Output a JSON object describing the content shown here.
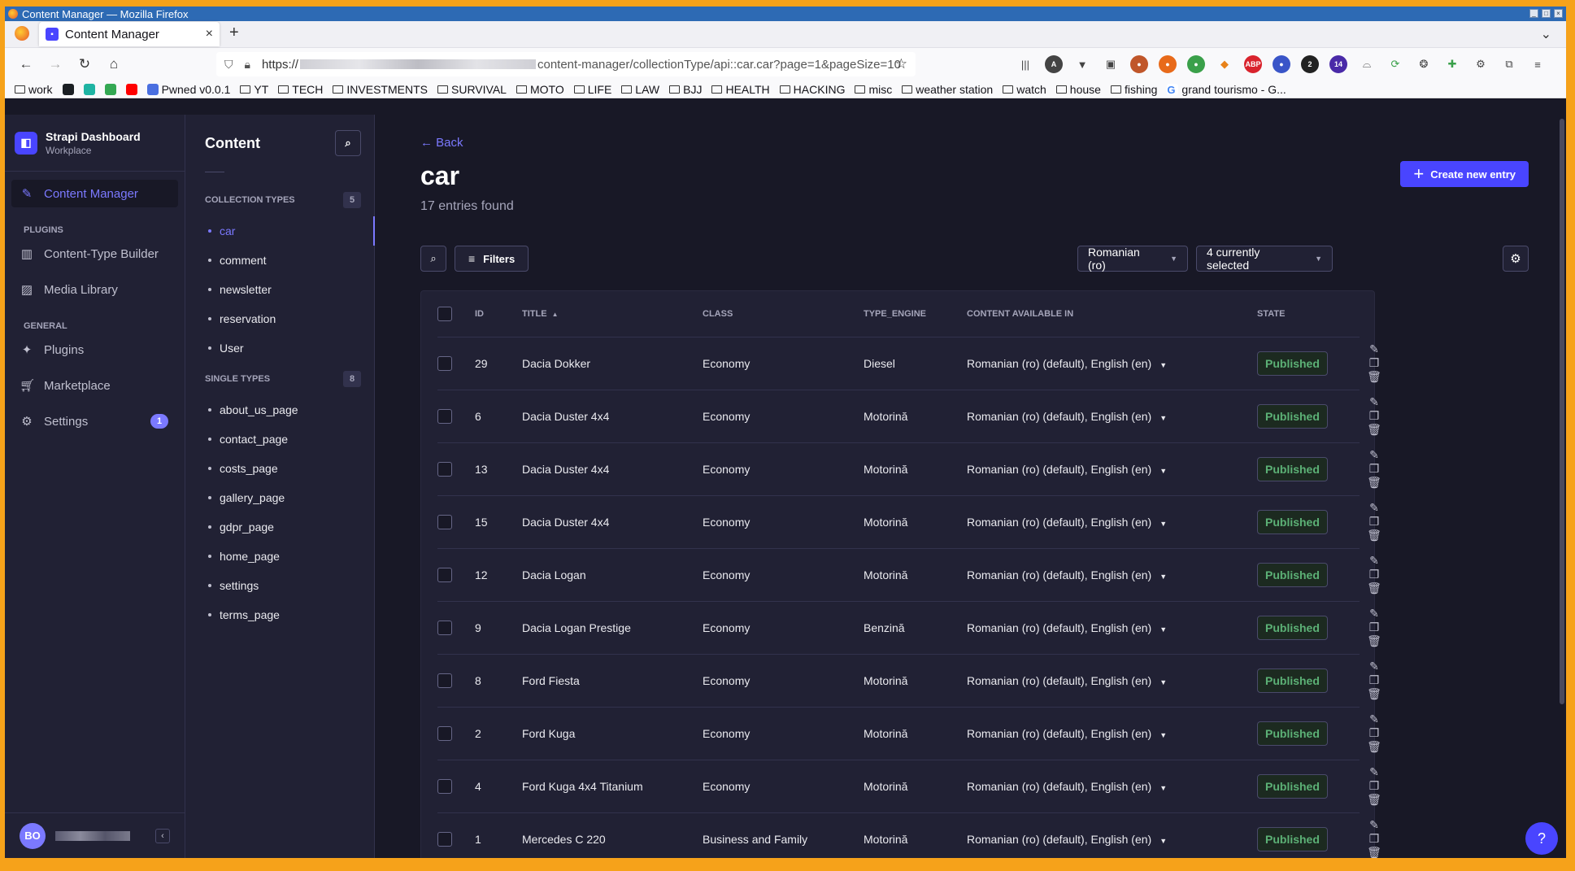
{
  "window": {
    "title": "Content Manager — Mozilla Firefox"
  },
  "browser": {
    "tab_title": "Content Manager",
    "url_prefix": "https://",
    "url_suffix": "content-manager/collectionType/api::car.car?page=1&pageSize=10"
  },
  "bookmarks": [
    {
      "label": "work",
      "type": "folder"
    },
    {
      "label": "",
      "type": "icon",
      "color": "#1b1f23"
    },
    {
      "label": "",
      "type": "icon",
      "color": "#1fb4a3"
    },
    {
      "label": "",
      "type": "icon",
      "color": "#34a853"
    },
    {
      "label": "",
      "type": "icon",
      "color": "#ff0000"
    },
    {
      "label": "Pwned v0.0.1",
      "type": "icon",
      "color": "#4a6fe0"
    },
    {
      "label": "YT",
      "type": "folder"
    },
    {
      "label": "TECH",
      "type": "folder"
    },
    {
      "label": "INVESTMENTS",
      "type": "folder"
    },
    {
      "label": "SURVIVAL",
      "type": "folder"
    },
    {
      "label": "MOTO",
      "type": "folder"
    },
    {
      "label": "LIFE",
      "type": "folder"
    },
    {
      "label": "LAW",
      "type": "folder"
    },
    {
      "label": "BJJ",
      "type": "folder"
    },
    {
      "label": "HEALTH",
      "type": "folder"
    },
    {
      "label": "HACKING",
      "type": "folder"
    },
    {
      "label": "misc",
      "type": "folder"
    },
    {
      "label": "weather station",
      "type": "folder"
    },
    {
      "label": "watch",
      "type": "folder"
    },
    {
      "label": "house",
      "type": "folder"
    },
    {
      "label": "fishing",
      "type": "folder"
    },
    {
      "label": "grand tourismo - G...",
      "type": "google"
    }
  ],
  "brand": {
    "name": "Strapi Dashboard",
    "workspace": "Workplace"
  },
  "sidebar": {
    "content_manager": "Content Manager",
    "plugins_heading": "PLUGINS",
    "content_type_builder": "Content-Type Builder",
    "media_library": "Media Library",
    "general_heading": "GENERAL",
    "plugins": "Plugins",
    "marketplace": "Marketplace",
    "settings": "Settings",
    "settings_badge": "1",
    "user_initials": "BO"
  },
  "subnav": {
    "title": "Content",
    "collection_heading": "COLLECTION TYPES",
    "collection_count": "5",
    "collection_types": [
      "car",
      "comment",
      "newsletter",
      "reservation",
      "User"
    ],
    "single_heading": "SINGLE TYPES",
    "single_count": "8",
    "single_types": [
      "about_us_page",
      "contact_page",
      "costs_page",
      "gallery_page",
      "gdpr_page",
      "home_page",
      "settings",
      "terms_page"
    ]
  },
  "main": {
    "back": "Back",
    "title": "car",
    "subtitle": "17 entries found",
    "create_button": "Create new entry",
    "filters": "Filters",
    "locale_select": "Romanian (ro)",
    "columns_select": "4 currently selected",
    "headers": {
      "id": "ID",
      "title": "TITLE",
      "class": "CLASS",
      "engine": "TYPE_ENGINE",
      "available": "CONTENT AVAILABLE IN",
      "state": "STATE"
    },
    "rows": [
      {
        "id": "29",
        "title": "Dacia Dokker",
        "class": "Economy",
        "engine": "Diesel",
        "available": "Romanian (ro) (default), English (en)",
        "state": "Published"
      },
      {
        "id": "6",
        "title": "Dacia Duster 4x4",
        "class": "Economy",
        "engine": "Motorină",
        "available": "Romanian (ro) (default), English (en)",
        "state": "Published"
      },
      {
        "id": "13",
        "title": "Dacia Duster 4x4",
        "class": "Economy",
        "engine": "Motorină",
        "available": "Romanian (ro) (default), English (en)",
        "state": "Published"
      },
      {
        "id": "15",
        "title": "Dacia Duster 4x4",
        "class": "Economy",
        "engine": "Motorină",
        "available": "Romanian (ro) (default), English (en)",
        "state": "Published"
      },
      {
        "id": "12",
        "title": "Dacia Logan",
        "class": "Economy",
        "engine": "Motorină",
        "available": "Romanian (ro) (default), English (en)",
        "state": "Published"
      },
      {
        "id": "9",
        "title": "Dacia Logan Prestige",
        "class": "Economy",
        "engine": "Benzină",
        "available": "Romanian (ro) (default), English (en)",
        "state": "Published"
      },
      {
        "id": "8",
        "title": "Ford Fiesta",
        "class": "Economy",
        "engine": "Motorină",
        "available": "Romanian (ro) (default), English (en)",
        "state": "Published"
      },
      {
        "id": "2",
        "title": "Ford Kuga",
        "class": "Economy",
        "engine": "Motorină",
        "available": "Romanian (ro) (default), English (en)",
        "state": "Published"
      },
      {
        "id": "4",
        "title": "Ford Kuga 4x4 Titanium",
        "class": "Economy",
        "engine": "Motorină",
        "available": "Romanian (ro) (default), English (en)",
        "state": "Published"
      },
      {
        "id": "1",
        "title": "Mercedes C 220",
        "class": "Business and Family",
        "engine": "Motorină",
        "available": "Romanian (ro) (default), English (en)",
        "state": "Published"
      }
    ]
  }
}
